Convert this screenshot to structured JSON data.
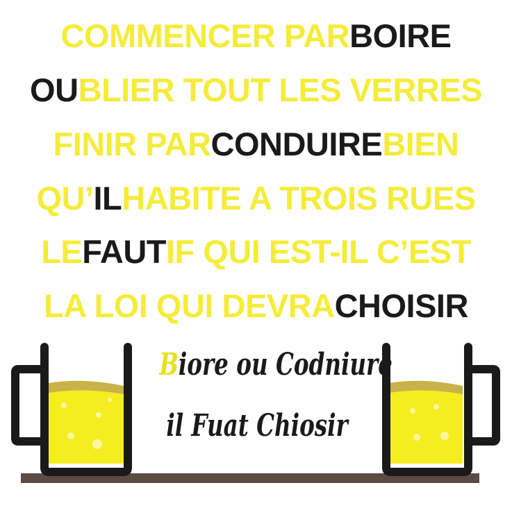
{
  "lines": [
    {
      "segments": [
        {
          "text": "COMMENCER PAR ",
          "hl": true
        },
        {
          "text": "BOIRE",
          "hl": false
        }
      ]
    },
    {
      "segments": [
        {
          "text": "OU",
          "hl": false
        },
        {
          "text": "BLIER TOUT LES VERRES",
          "hl": true
        }
      ]
    },
    {
      "segments": [
        {
          "text": "FINIR PAR ",
          "hl": true
        },
        {
          "text": "CONDUIRE",
          "hl": false
        },
        {
          "text": " BIEN",
          "hl": true
        }
      ]
    },
    {
      "segments": [
        {
          "text": "QU’",
          "hl": true
        },
        {
          "text": "IL",
          "hl": false
        },
        {
          "text": " HABITE A TROIS RUES",
          "hl": true
        }
      ]
    },
    {
      "segments": [
        {
          "text": "LE ",
          "hl": true
        },
        {
          "text": "FAUT",
          "hl": false
        },
        {
          "text": "IF QUI EST-IL C’EST",
          "hl": true
        }
      ]
    },
    {
      "segments": [
        {
          "text": "LA LOI QUI DEVRA ",
          "hl": true
        },
        {
          "text": "CHOISIR",
          "hl": false
        }
      ]
    }
  ],
  "poster": {
    "line1": "Biore ou Codniure",
    "line2": "il Fuat Chiosir"
  },
  "colors": {
    "highlight": "#f7f22a",
    "beer": "#f4ee20",
    "foam": "#c8b24a",
    "mug_outline": "#1a1a1a",
    "table": "#5b4a45"
  }
}
